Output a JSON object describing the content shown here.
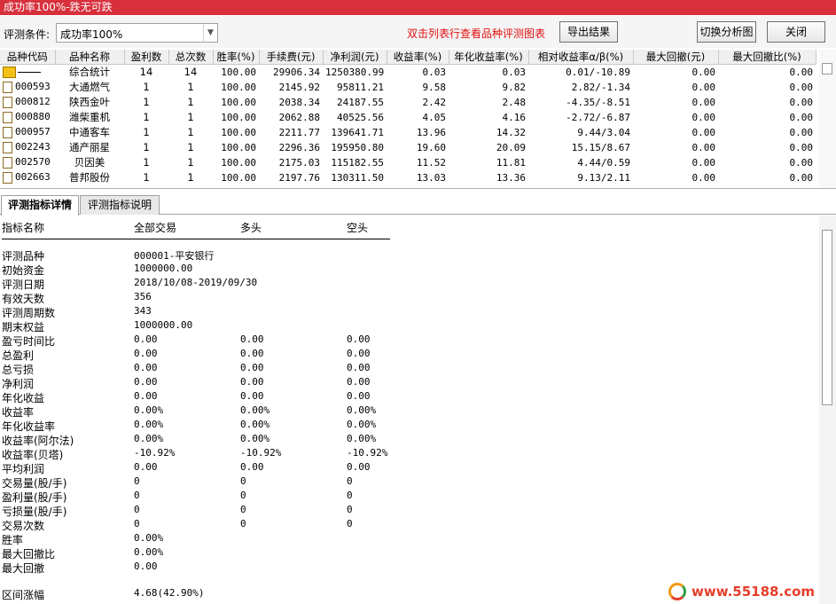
{
  "window": {
    "title": "成功率100%-跌无可跌"
  },
  "toolbar": {
    "condition_label": "评测条件:",
    "condition_value": "成功率100%",
    "hint": "双击列表行查看品种评测图表",
    "export_label": "导出结果",
    "switch_label": "切换分析图",
    "close_label": "关闭"
  },
  "table": {
    "columns": [
      "品种代码",
      "品种名称",
      "盈利数",
      "总次数",
      "胜率(%)",
      "手续费(元)",
      "净利润(元)",
      "收益率(%)",
      "年化收益率(%)",
      "相对收益率α/β(%)",
      "最大回撤(元)",
      "最大回撤比(%)"
    ],
    "summary": {
      "name": "综合统计",
      "wins": "14",
      "total": "14",
      "winrate": "100.00",
      "fee": "29906.34",
      "profit": "1250380.99",
      "ret": "0.03",
      "annual": "0.03",
      "relative": "0.01/-10.89",
      "maxdd": "0.00",
      "maxddr": "0.00"
    },
    "rows": [
      {
        "code": "000593",
        "name": "大通燃气",
        "wins": "1",
        "total": "1",
        "winrate": "100.00",
        "fee": "2145.92",
        "profit": "95811.21",
        "ret": "9.58",
        "annual": "9.82",
        "relative": "2.82/-1.34",
        "maxdd": "0.00",
        "maxddr": "0.00"
      },
      {
        "code": "000812",
        "name": "陕西金叶",
        "wins": "1",
        "total": "1",
        "winrate": "100.00",
        "fee": "2038.34",
        "profit": "24187.55",
        "ret": "2.42",
        "annual": "2.48",
        "relative": "-4.35/-8.51",
        "maxdd": "0.00",
        "maxddr": "0.00"
      },
      {
        "code": "000880",
        "name": "潍柴重机",
        "wins": "1",
        "total": "1",
        "winrate": "100.00",
        "fee": "2062.88",
        "profit": "40525.56",
        "ret": "4.05",
        "annual": "4.16",
        "relative": "-2.72/-6.87",
        "maxdd": "0.00",
        "maxddr": "0.00"
      },
      {
        "code": "000957",
        "name": "中通客车",
        "wins": "1",
        "total": "1",
        "winrate": "100.00",
        "fee": "2211.77",
        "profit": "139641.71",
        "ret": "13.96",
        "annual": "14.32",
        "relative": "9.44/3.04",
        "maxdd": "0.00",
        "maxddr": "0.00"
      },
      {
        "code": "002243",
        "name": "通产丽星",
        "wins": "1",
        "total": "1",
        "winrate": "100.00",
        "fee": "2296.36",
        "profit": "195950.80",
        "ret": "19.60",
        "annual": "20.09",
        "relative": "15.15/8.67",
        "maxdd": "0.00",
        "maxddr": "0.00"
      },
      {
        "code": "002570",
        "name": "贝因美",
        "wins": "1",
        "total": "1",
        "winrate": "100.00",
        "fee": "2175.03",
        "profit": "115182.55",
        "ret": "11.52",
        "annual": "11.81",
        "relative": "4.44/0.59",
        "maxdd": "0.00",
        "maxddr": "0.00"
      },
      {
        "code": "002663",
        "name": "普邦股份",
        "wins": "1",
        "total": "1",
        "winrate": "100.00",
        "fee": "2197.76",
        "profit": "130311.50",
        "ret": "13.03",
        "annual": "13.36",
        "relative": "9.13/2.11",
        "maxdd": "0.00",
        "maxddr": "0.00"
      }
    ]
  },
  "tabs": [
    {
      "label": "评测指标详情"
    },
    {
      "label": "评测指标说明"
    }
  ],
  "details": {
    "headers": [
      "指标名称",
      "全部交易",
      "多头",
      "空头"
    ],
    "rows": [
      {
        "name": "评测品种",
        "v": [
          "000001-平安银行",
          "",
          ""
        ]
      },
      {
        "name": "初始资金",
        "v": [
          "1000000.00",
          "",
          ""
        ]
      },
      {
        "name": "评测日期",
        "v": [
          "2018/10/08-2019/09/30",
          "",
          ""
        ]
      },
      {
        "name": "有效天数",
        "v": [
          "356",
          "",
          ""
        ]
      },
      {
        "name": "评测周期数",
        "v": [
          "343",
          "",
          ""
        ]
      },
      {
        "name": "期末权益",
        "v": [
          "1000000.00",
          "",
          ""
        ]
      },
      {
        "name": "盈亏时间比",
        "v": [
          "0.00",
          "0.00",
          "0.00"
        ]
      },
      {
        "name": "总盈利",
        "v": [
          "0.00",
          "0.00",
          "0.00"
        ]
      },
      {
        "name": "总亏损",
        "v": [
          "0.00",
          "0.00",
          "0.00"
        ]
      },
      {
        "name": "净利润",
        "v": [
          "0.00",
          "0.00",
          "0.00"
        ]
      },
      {
        "name": "年化收益",
        "v": [
          "0.00",
          "0.00",
          "0.00"
        ]
      },
      {
        "name": "收益率",
        "v": [
          "0.00%",
          "0.00%",
          "0.00%"
        ]
      },
      {
        "name": "年化收益率",
        "v": [
          "0.00%",
          "0.00%",
          "0.00%"
        ]
      },
      {
        "name": "收益率(阿尔法)",
        "v": [
          "0.00%",
          "0.00%",
          "0.00%"
        ]
      },
      {
        "name": "收益率(贝塔)",
        "v": [
          "-10.92%",
          "-10.92%",
          "-10.92%"
        ]
      },
      {
        "name": "平均利润",
        "v": [
          "0.00",
          "0.00",
          "0.00"
        ]
      },
      {
        "name": "交易量(股/手)",
        "v": [
          "0",
          "0",
          "0"
        ]
      },
      {
        "name": "盈利量(股/手)",
        "v": [
          "0",
          "0",
          "0"
        ]
      },
      {
        "name": "亏损量(股/手)",
        "v": [
          "0",
          "0",
          "0"
        ]
      },
      {
        "name": "交易次数",
        "v": [
          "0",
          "0",
          "0"
        ]
      },
      {
        "name": "胜率",
        "v": [
          "0.00%",
          "",
          ""
        ]
      },
      {
        "name": "最大回撤比",
        "v": [
          "0.00%",
          "",
          ""
        ]
      },
      {
        "name": "最大回撤",
        "v": [
          "0.00",
          "",
          ""
        ]
      }
    ],
    "range_label": "区间涨幅",
    "range_value": "4.68(42.90%)"
  },
  "watermark": "www.55188.com"
}
